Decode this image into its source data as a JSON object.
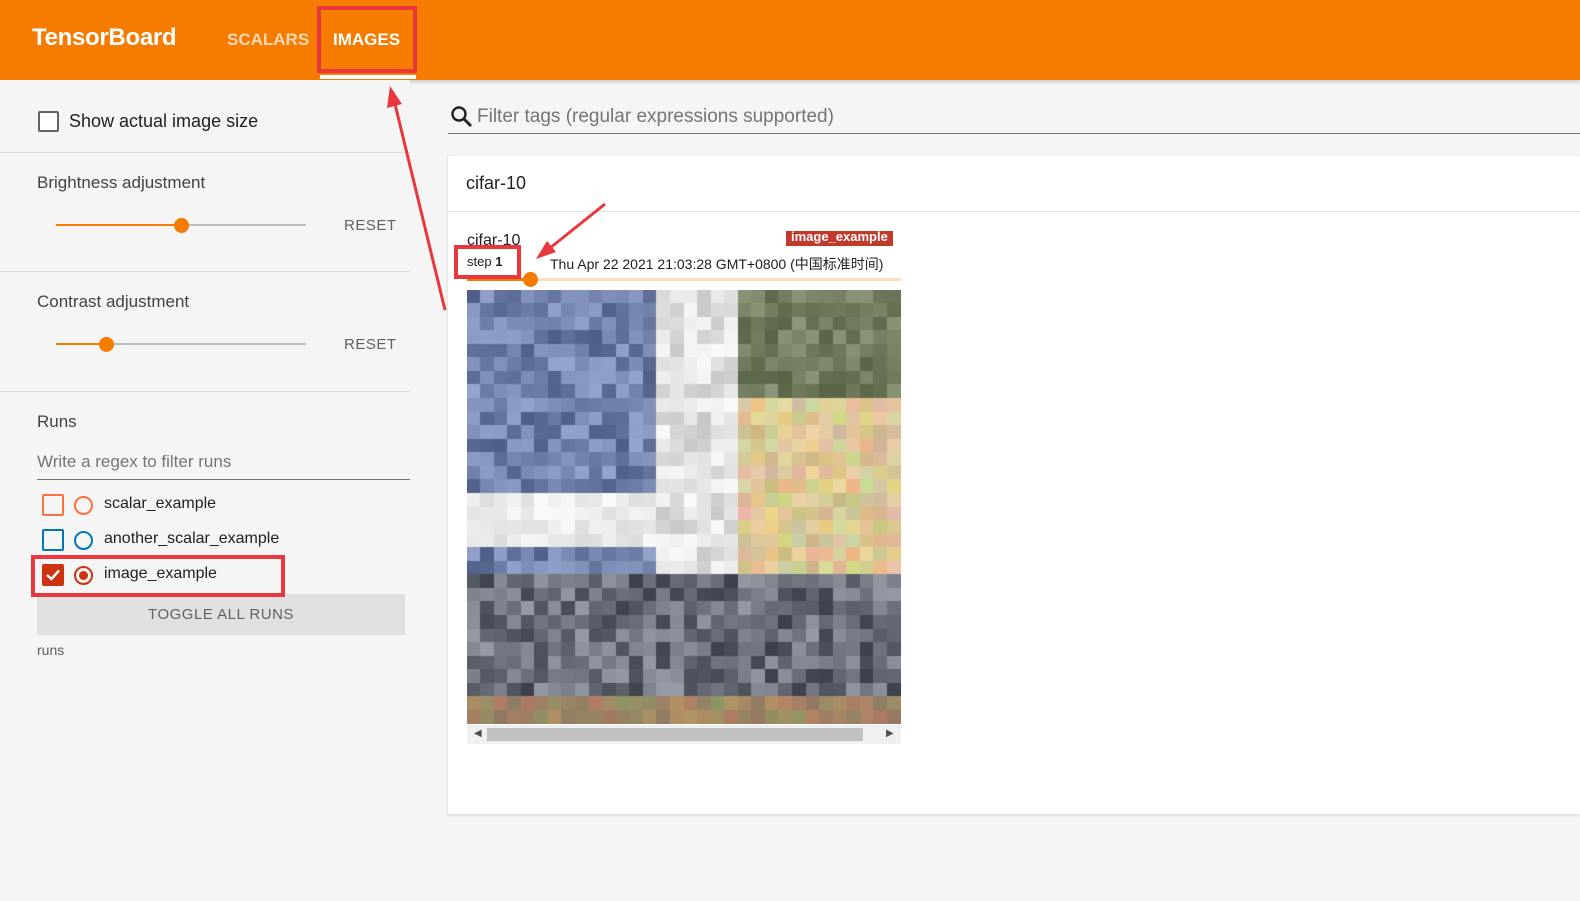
{
  "header": {
    "brand": "TensorBoard",
    "tabs": [
      {
        "label": "SCALARS"
      },
      {
        "label": "IMAGES"
      }
    ]
  },
  "sidebar": {
    "show_actual_size": {
      "label": "Show actual image size",
      "checked": false
    },
    "brightness": {
      "title": "Brightness adjustment",
      "reset": "RESET",
      "value": 0.5
    },
    "contrast": {
      "title": "Contrast adjustment",
      "reset": "RESET",
      "value": 0.2
    },
    "runs": {
      "title": "Runs",
      "filter_placeholder": "Write a regex to filter runs",
      "items": [
        {
          "label": "scalar_example",
          "checked": false,
          "color": "#ff7043"
        },
        {
          "label": "another_scalar_example",
          "checked": false,
          "color": "#0077bb"
        },
        {
          "label": "image_example",
          "checked": true,
          "color": "#cc3311"
        }
      ],
      "toggle_all": "TOGGLE ALL RUNS",
      "footer": "runs"
    }
  },
  "main": {
    "search_placeholder": "Filter tags (regular expressions supported)",
    "card": {
      "title": "cifar-10",
      "image": {
        "tag": "cifar-10",
        "run_chip": "image_example",
        "step_label": "step",
        "step_value": "1",
        "timestamp": "Thu Apr 22 2021 21:03:28 GMT+0800 (中国标准时间)"
      }
    }
  },
  "colors": {
    "accent": "#f57c00",
    "annotation": "#e8383d"
  }
}
